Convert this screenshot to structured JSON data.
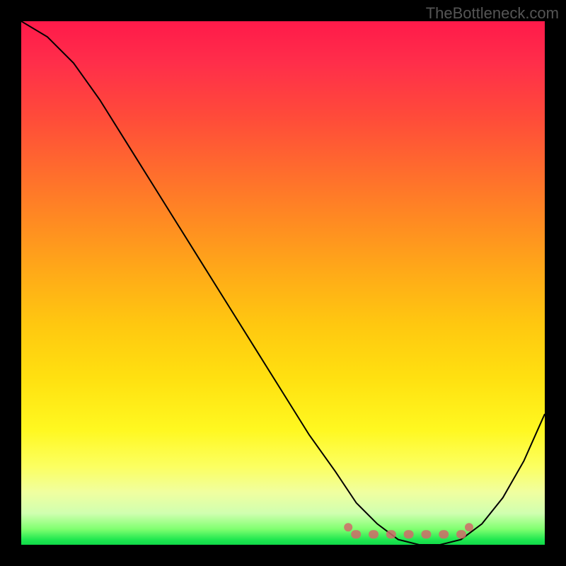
{
  "watermark": "TheBottleneck.com",
  "chart_data": {
    "type": "line",
    "title": "",
    "xlabel": "",
    "ylabel": "",
    "xlim": [
      0,
      100
    ],
    "ylim": [
      0,
      100
    ],
    "series": [
      {
        "name": "bottleneck-curve",
        "x": [
          0,
          5,
          10,
          15,
          20,
          25,
          30,
          35,
          40,
          45,
          50,
          55,
          60,
          64,
          68,
          72,
          76,
          80,
          84,
          88,
          92,
          96,
          100
        ],
        "y": [
          100,
          97,
          92,
          85,
          77,
          69,
          61,
          53,
          45,
          37,
          29,
          21,
          14,
          8,
          4,
          1,
          0,
          0,
          1,
          4,
          9,
          16,
          25
        ]
      }
    ],
    "optimal_marker": {
      "name": "optimal-range-dots",
      "x_range": [
        63,
        85
      ],
      "y": 2,
      "color": "#d06a6a"
    },
    "background_gradient": {
      "top": "#ff1a4a",
      "bottom": "#10d848",
      "meaning": "red=high bottleneck, green=low bottleneck"
    }
  }
}
